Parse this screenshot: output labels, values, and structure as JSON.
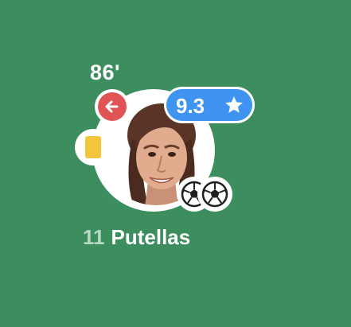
{
  "player": {
    "number": "11",
    "name": "Putellas",
    "rating": "9.3",
    "substitution_minute": "86'"
  },
  "badges": {
    "substitution_icon": "arrow-left-icon",
    "rating_icon": "star-icon",
    "card_icon": "yellow-card-icon",
    "goal_icon": "football-icon",
    "goals": 2
  },
  "colors": {
    "pitch": "#3c8e5e",
    "rating": "#3e94f0",
    "substitution": "#e15455",
    "yellow_card": "#f4c63d"
  }
}
